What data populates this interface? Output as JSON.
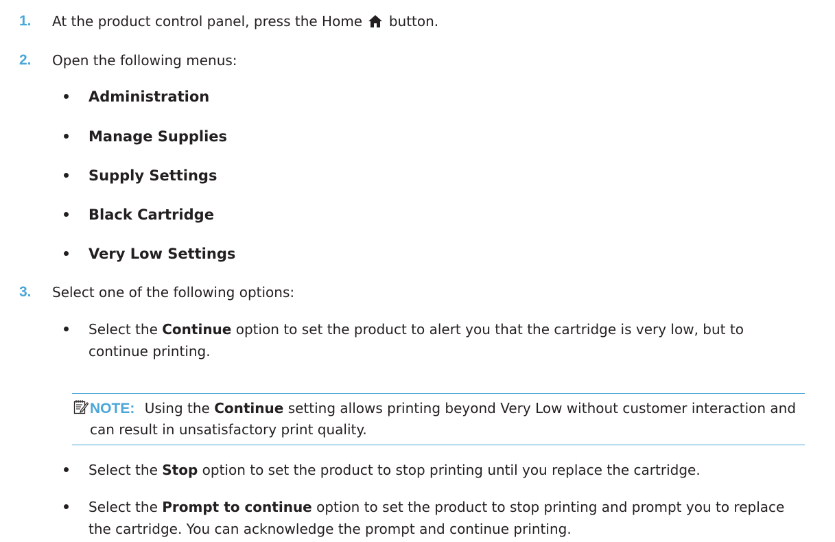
{
  "steps": [
    {
      "number": "1.",
      "text_before_icon": "At the product control panel, press the Home",
      "icon": "home-icon",
      "text_after_icon": "button."
    },
    {
      "number": "2.",
      "text": "Open the following menus:"
    },
    {
      "number": "3.",
      "text": "Select one of the following options:"
    }
  ],
  "menus": [
    "Administration",
    "Manage Supplies",
    "Supply Settings",
    "Black Cartridge",
    "Very Low Settings"
  ],
  "options": [
    {
      "prefix": "Select the",
      "option": "Continue",
      "suffix": "option to set the product to alert you that the cartridge is very low, but to continue printing."
    },
    {
      "prefix": "Select the",
      "option": "Stop",
      "suffix": "option to set the product to stop printing until you replace the cartridge."
    },
    {
      "prefix": "Select the",
      "option": "Prompt to continue",
      "suffix": "option to set the product to stop printing and prompt you to replace the cartridge. You can acknowledge the prompt and continue printing."
    }
  ],
  "note": {
    "label": "NOTE:",
    "prefix": "Using the",
    "setting": "Continue",
    "suffix": "setting allows printing beyond Very Low without customer interaction and can result in unsatisfactory print quality.",
    "icon": "note-icon"
  },
  "colors": {
    "accent": "#4aa7d8",
    "text": "#231f20"
  }
}
